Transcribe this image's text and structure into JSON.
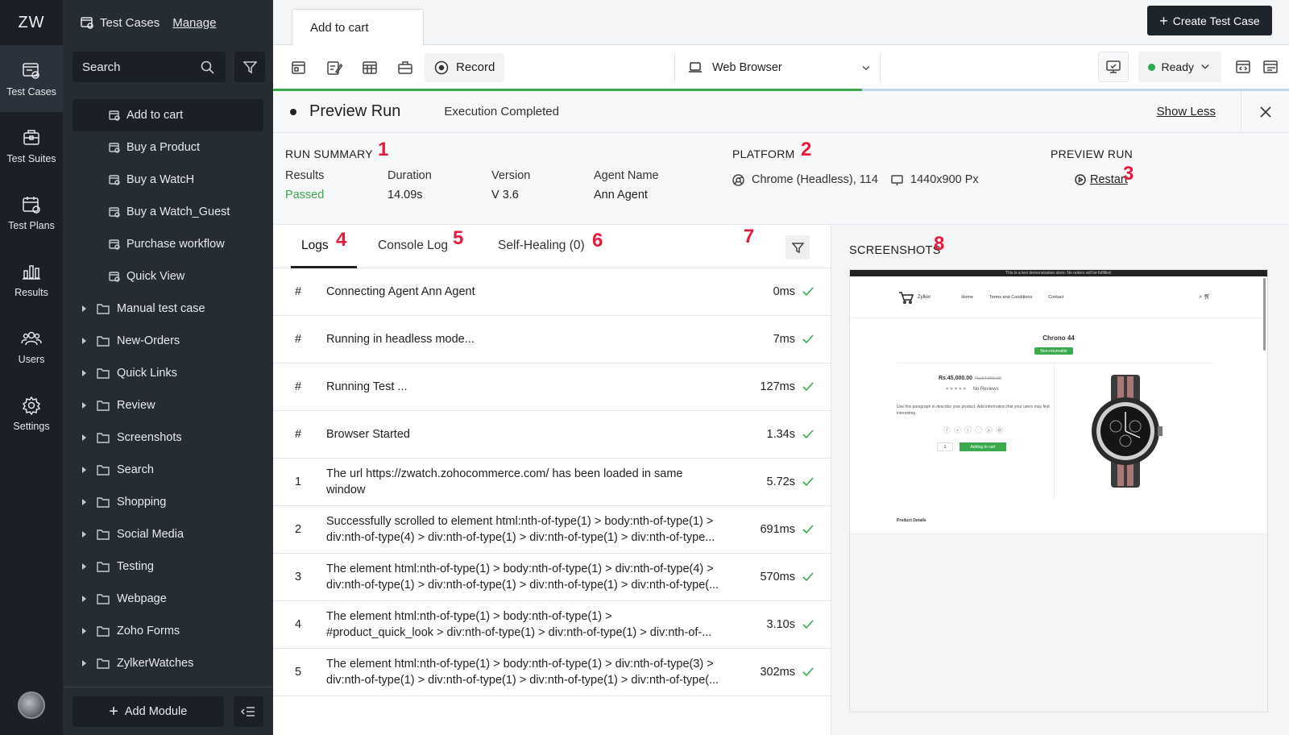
{
  "app": {
    "logo": "ZW"
  },
  "rail": [
    {
      "label": "Test Cases",
      "icon": "test-cases-icon",
      "active": true
    },
    {
      "label": "Test Suites",
      "icon": "test-suites-icon"
    },
    {
      "label": "Test Plans",
      "icon": "test-plans-icon"
    },
    {
      "label": "Results",
      "icon": "results-icon"
    },
    {
      "label": "Users",
      "icon": "users-icon"
    },
    {
      "label": "Settings",
      "icon": "gear-icon"
    }
  ],
  "sidebar": {
    "title": "Test Cases",
    "manage": "Manage",
    "search_placeholder": "Search",
    "test_cases": [
      "Add to cart",
      "Buy a Product",
      "Buy a WatcH",
      "Buy a Watch_Guest",
      "Purchase workflow",
      "Quick View"
    ],
    "folders": [
      "Manual test case",
      "New-Orders",
      "Quick Links",
      "Review",
      "Screenshots",
      "Search",
      "Shopping",
      "Social Media",
      "Testing",
      "Webpage",
      "Zoho Forms",
      "ZylkerWatches"
    ],
    "add_module": "Add Module"
  },
  "header": {
    "tab": "Add to cart",
    "create_button": "Create Test Case"
  },
  "toolbar": {
    "record": "Record",
    "browser": "Web Browser",
    "status": "Ready",
    "progress": 0.58,
    "status_color": "#2fa84f"
  },
  "preview": {
    "title": "Preview Run",
    "status": "Execution Completed",
    "show_less": "Show Less"
  },
  "summary": {
    "run_summary_title": "RUN SUMMARY",
    "results_label": "Results",
    "results_value": "Passed",
    "duration_label": "Duration",
    "duration_value": "14.09s",
    "version_label": "Version",
    "version_value": "V 3.6",
    "agent_label": "Agent Name",
    "agent_value": "Ann Agent",
    "platform_title": "PLATFORM",
    "browser": "Chrome (Headless), 114",
    "resolution": "1440x900 Px",
    "preview_run_title": "PREVIEW RUN",
    "restart": "Restart",
    "success_color": "#3aaa4d"
  },
  "annotations": [
    "1",
    "2",
    "3",
    "4",
    "5",
    "6",
    "7",
    "8"
  ],
  "logs": {
    "tabs": [
      "Logs",
      "Console Log",
      "Self-Healing (0)"
    ],
    "rows": [
      {
        "num": "#",
        "lines": [
          "Connecting Agent Ann Agent"
        ],
        "dur": "0ms"
      },
      {
        "num": "#",
        "lines": [
          "Running in headless mode..."
        ],
        "dur": "7ms"
      },
      {
        "num": "#",
        "lines": [
          "Running Test ..."
        ],
        "dur": "127ms"
      },
      {
        "num": "#",
        "lines": [
          "Browser Started"
        ],
        "dur": "1.34s"
      },
      {
        "num": "1",
        "lines": [
          "The url https://zwatch.zohocommerce.com/ has been loaded in same",
          "window"
        ],
        "dur": "5.72s"
      },
      {
        "num": "2",
        "lines": [
          "Successfully scrolled to element html:nth-of-type(1) > body:nth-of-type(1) >",
          "div:nth-of-type(4) > div:nth-of-type(1) > div:nth-of-type(1) > div:nth-of-type..."
        ],
        "dur": "691ms"
      },
      {
        "num": "3",
        "lines": [
          "The element html:nth-of-type(1) > body:nth-of-type(1) > div:nth-of-type(4) >",
          "div:nth-of-type(1) > div:nth-of-type(1) > div:nth-of-type(1) > div:nth-of-type(..."
        ],
        "dur": "570ms"
      },
      {
        "num": "4",
        "lines": [
          "The element html:nth-of-type(1) > body:nth-of-type(1) >",
          "#product_quick_look > div:nth-of-type(1) > div:nth-of-type(1) > div:nth-of-..."
        ],
        "dur": "3.10s"
      },
      {
        "num": "5",
        "lines": [
          "The element html:nth-of-type(1) > body:nth-of-type(1) > div:nth-of-type(3) >",
          "div:nth-of-type(1) > div:nth-of-type(1) > div:nth-of-type(1) > div:nth-of-type(..."
        ],
        "dur": "302ms"
      }
    ]
  },
  "screenshots": {
    "title": "SCREENSHOTS",
    "page": {
      "banner": "This is a test demonstration store. No orders will be fulfilled.",
      "brand": "Zylker",
      "nav": [
        "Home",
        "Terms and Conditions",
        "Contact"
      ],
      "product": "Chrono 44",
      "badge": "Non-returnable",
      "price": "Rs.45,000.00",
      "old_price": "Rs.57,000.00",
      "reviews": "No Reviews",
      "description": "Use this paragraph to describe your product. Add information that your users may find interesting.",
      "qty": "1",
      "cart": "Adding to cart",
      "details": "Product Details"
    }
  }
}
